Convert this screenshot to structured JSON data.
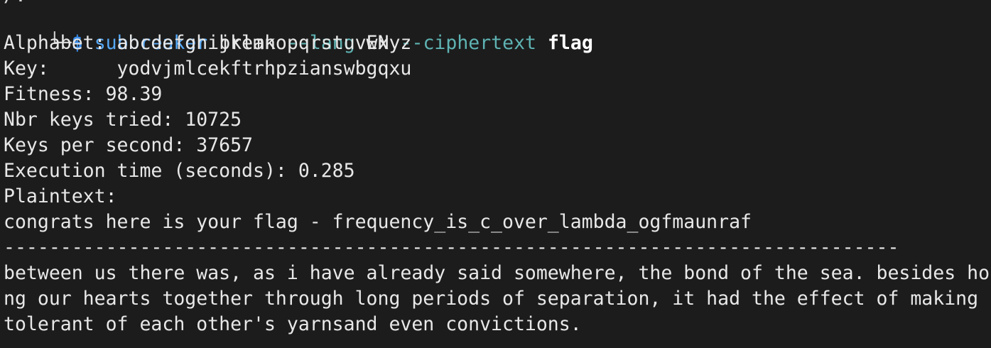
{
  "prompt": {
    "partial_previous_line": "/.",
    "corner": "└─",
    "symbol": "$",
    "command_name": "subbreaker",
    "arg_1": "break",
    "flag_1": "--lang",
    "value_1": "EN",
    "flag_2": "--ciphertext",
    "value_2": "flag"
  },
  "output": {
    "alphabet": "Alphabet: abcdefghijklmnopqrstuvwxyz",
    "key": "Key:      yodvjmlcekftrhpzianswbgqxu",
    "fitness": "Fitness: 98.39",
    "keys_tried": "Nbr keys tried: 10725",
    "keys_per_second": "Keys per second: 37657",
    "execution_time": "Execution time (seconds): 0.285",
    "plaintext_label": "Plaintext:",
    "plaintext": "congrats here is your flag - frequency_is_c_over_lambda_ogfmaunraf",
    "separator": "-------------------------------------------------------------------------------",
    "text_line_1": "between us there was, as i have already said somewhere, the bond of the sea. besides ho",
    "text_line_2": "ng our hearts together through long periods of separation, it had the effect of making",
    "text_line_3": "tolerant of each other's yarnsand even convictions."
  },
  "colors": {
    "background": "#1c1c1c",
    "foreground": "#e8e8e8",
    "prompt_symbol": "#3b8eea",
    "command": "#56a8f5",
    "flag": "#5fb3b3"
  }
}
